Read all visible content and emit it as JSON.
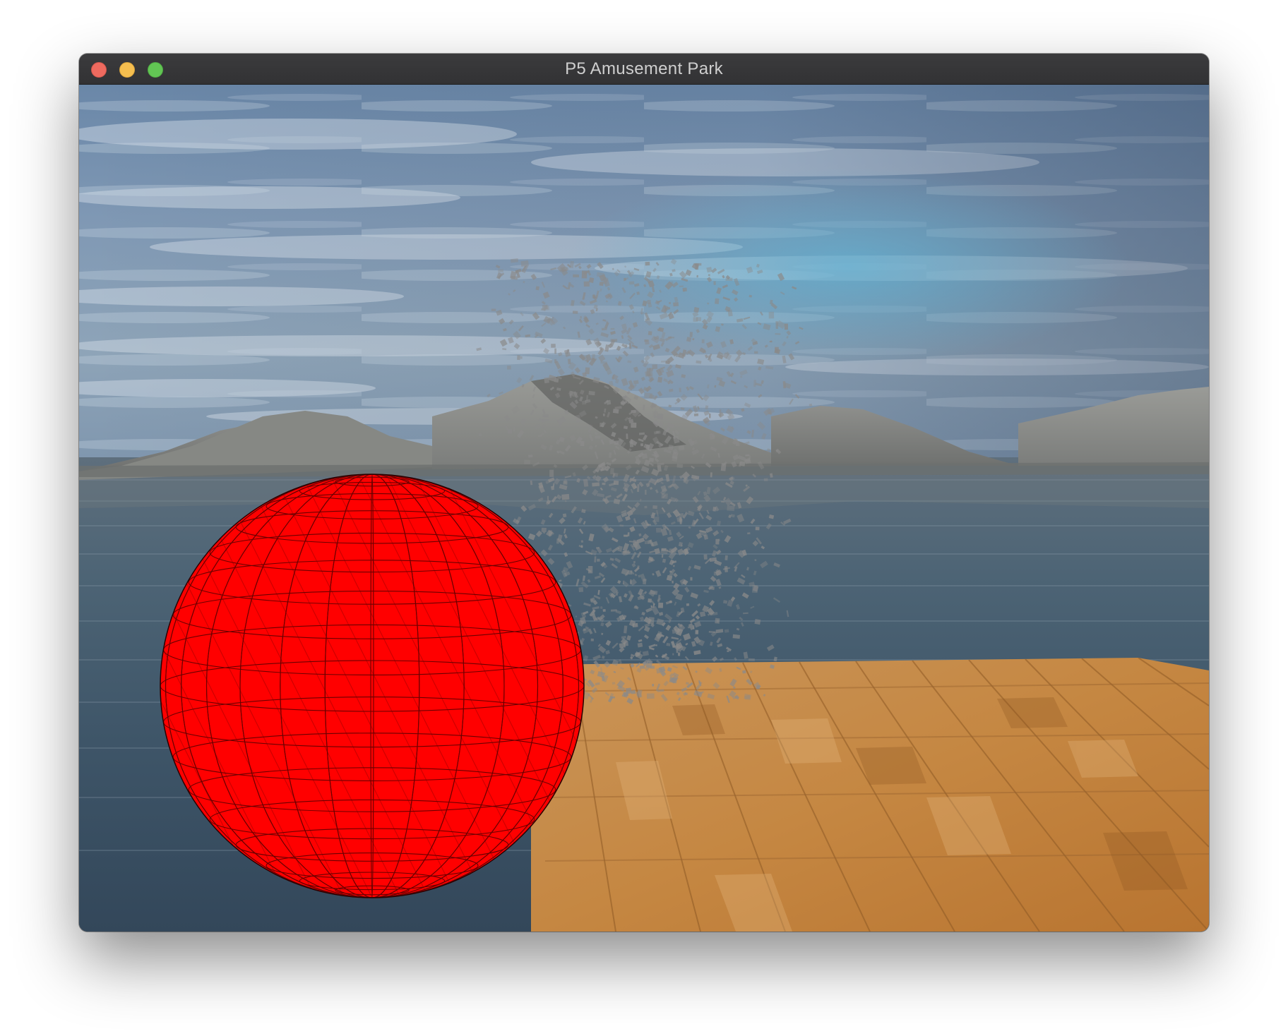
{
  "window": {
    "title": "P5 Amusement Park"
  },
  "colors": {
    "sphere": "#ff0000",
    "floor_wood": "#c98a45",
    "water": "#41566a",
    "sky": "#6f8aa6",
    "particles": "#8a8a8a"
  },
  "icons": {
    "close": "close-window-dot",
    "minimize": "minimize-window-dot",
    "maximize": "maximize-window-dot"
  }
}
